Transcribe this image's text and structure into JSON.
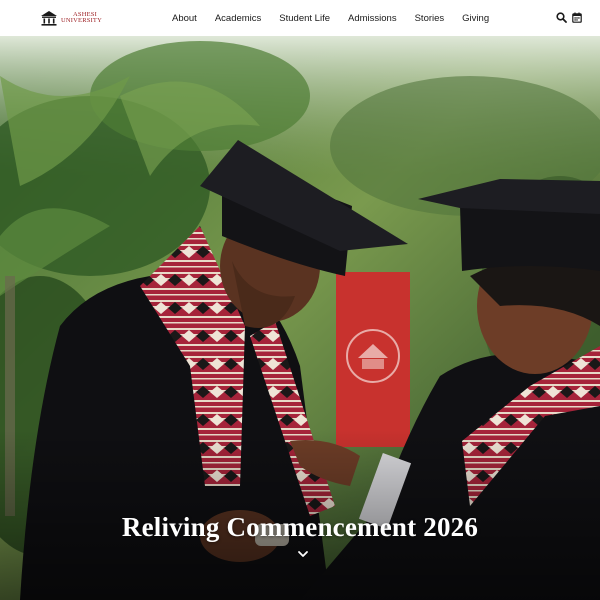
{
  "header": {
    "logo": {
      "line1": "Ashesi",
      "line2": "University"
    },
    "nav": [
      {
        "label": "About"
      },
      {
        "label": "Academics"
      },
      {
        "label": "Student Life"
      },
      {
        "label": "Admissions"
      },
      {
        "label": "Stories"
      },
      {
        "label": "Giving"
      }
    ],
    "icons": [
      "search-icon",
      "calendar-icon"
    ]
  },
  "hero": {
    "title": "Reliving Commencement 2026",
    "scroll_icon": "chevron-down-icon"
  },
  "colors": {
    "brand": "#9b1b1f",
    "nav_text": "#1a1a1a",
    "hero_text": "#ffffff"
  }
}
